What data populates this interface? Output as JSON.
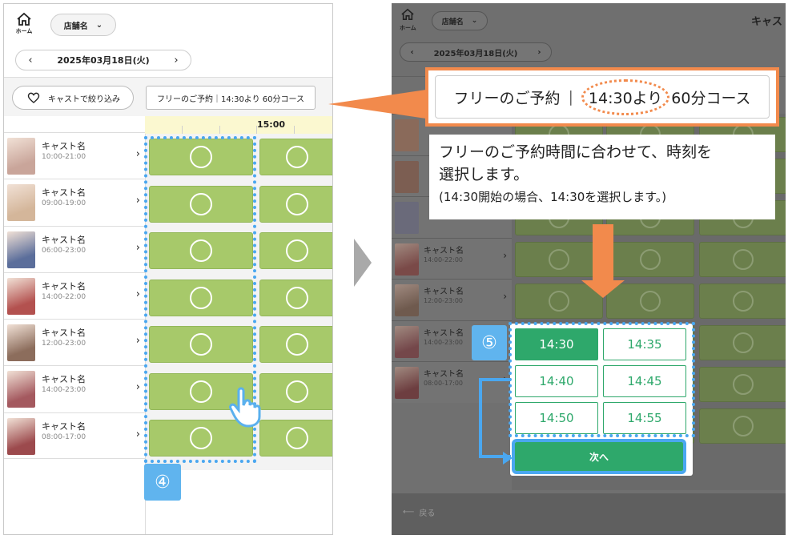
{
  "left": {
    "home_label": "ホーム",
    "store_select": "店舗名",
    "date": "2025年03月18日(火)",
    "date_prev": "‹",
    "date_next": "›",
    "cast_filter": "キャストで絞り込み",
    "course_info": "フリーのご予約｜14:30より 60分コース",
    "time_header": "15:00",
    "casts": [
      {
        "name": "キャスト名",
        "hours": "10:00-21:00",
        "color": "#c9a59a"
      },
      {
        "name": "キャスト名",
        "hours": "09:00-19:00",
        "color": "#d4b69a"
      },
      {
        "name": "キャスト名",
        "hours": "06:00-23:00",
        "color": "#5b6e9b"
      },
      {
        "name": "キャスト名",
        "hours": "14:00-22:00",
        "color": "#b3514f"
      },
      {
        "name": "キャスト名",
        "hours": "12:00-23:00",
        "color": "#8c6d5c"
      },
      {
        "name": "キャスト名",
        "hours": "14:00-23:00",
        "color": "#a4595f"
      },
      {
        "name": "キャスト名",
        "hours": "08:00-17:00",
        "color": "#9c4a4d"
      }
    ],
    "step_badge": "④"
  },
  "right": {
    "home_label": "ホーム",
    "store_select": "店舗名",
    "title": "キャス",
    "date": "2025年03月18日(火)",
    "date_prev": "‹",
    "date_next": "›",
    "casts": [
      {
        "name": "キャスト名",
        "hours": "14:00-22:00",
        "color": "#7a4a48"
      },
      {
        "name": "キャスト名",
        "hours": "12:00-23:00",
        "color": "#6f5a4e"
      },
      {
        "name": "キャスト名",
        "hours": "14:00-23:00",
        "color": "#74474a"
      },
      {
        "name": "キャスト名",
        "hours": "08:00-17:00",
        "color": "#6d3e40"
      }
    ],
    "back_label": "戻る",
    "callout": {
      "part1": "フリーのご予約",
      "sep": "|",
      "time": "14:30より",
      "course": "60分コース"
    },
    "instruction_main_1": "フリーのご予約時間に合わせて、時刻を",
    "instruction_main_2": "選択します。",
    "instruction_sub": "(14:30開始の場合、14:30を選択します。)",
    "step_badge": "⑤",
    "times": [
      {
        "label": "14:30",
        "selected": true
      },
      {
        "label": "14:35",
        "selected": false
      },
      {
        "label": "14:40",
        "selected": false
      },
      {
        "label": "14:45",
        "selected": false
      },
      {
        "label": "14:50",
        "selected": false
      },
      {
        "label": "14:55",
        "selected": false
      }
    ],
    "next_label": "次へ"
  },
  "colors": {
    "accent_green": "#2ea86b",
    "slot_green": "#a7c96a",
    "highlight_blue": "#4aa7f0",
    "callout_orange": "#f28a4c"
  }
}
